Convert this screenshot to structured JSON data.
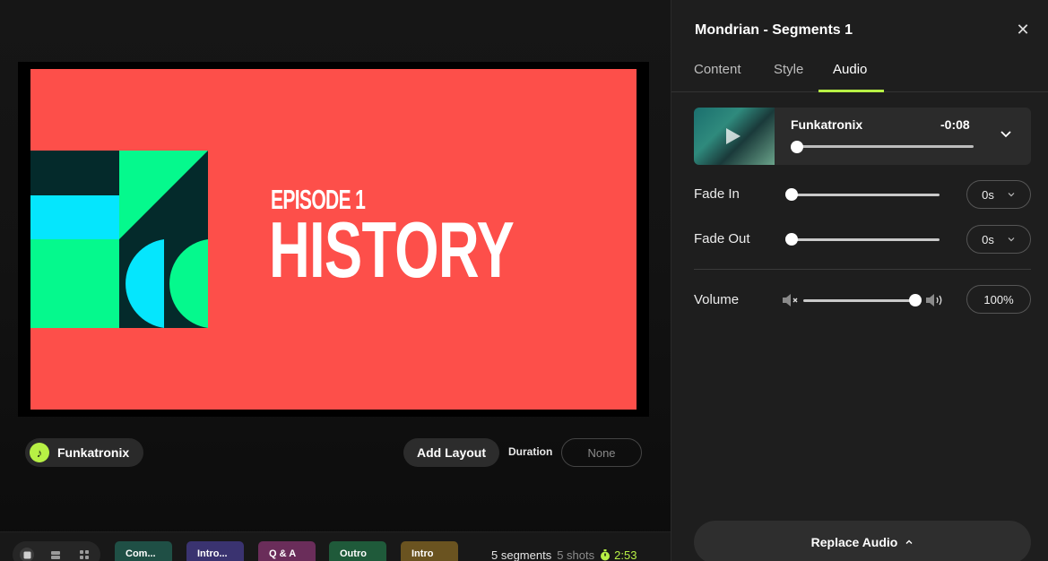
{
  "preview": {
    "episode_label": "EPISODE 1",
    "title": "HISTORY",
    "slide_bg": "#fd4f4a"
  },
  "audio_chip": {
    "label": "Funkatronix",
    "icon": "music-note-icon"
  },
  "layout": {
    "add_label": "Add Layout",
    "duration_label": "Duration",
    "duration_value": "None"
  },
  "timeline": {
    "view_icons": [
      "single-view-icon",
      "list-view-icon",
      "grid-view-icon"
    ],
    "segments": [
      {
        "label": "Com...",
        "color": "#1f4f45"
      },
      {
        "label": "Intro...",
        "color": "#3a3370"
      },
      {
        "label": "Q & A",
        "color": "#6a2d5a"
      },
      {
        "label": "Outro",
        "color": "#1f5a3a"
      },
      {
        "label": "Intro",
        "color": "#6a5320"
      }
    ],
    "segments_count": "5 segments",
    "shots_count": "5 shots",
    "total_time": "2:53"
  },
  "panel": {
    "title": "Mondrian - Segments 1",
    "tabs": [
      {
        "label": "Content"
      },
      {
        "label": "Style"
      },
      {
        "label": "Audio"
      }
    ],
    "active_tab": "Audio",
    "track": {
      "name": "Funkatronix",
      "time": "-0:08",
      "progress": 0
    },
    "fade_in": {
      "label": "Fade In",
      "value": "0s",
      "level": 0
    },
    "fade_out": {
      "label": "Fade Out",
      "value": "0s",
      "level": 0
    },
    "volume": {
      "label": "Volume",
      "value": "100%",
      "level": 1.0
    },
    "replace_label": "Replace Audio"
  },
  "colors": {
    "accent": "#b7f045",
    "art_cyan": "#05e6fd",
    "art_green": "#05f98d",
    "art_dark": "#042a2b"
  }
}
